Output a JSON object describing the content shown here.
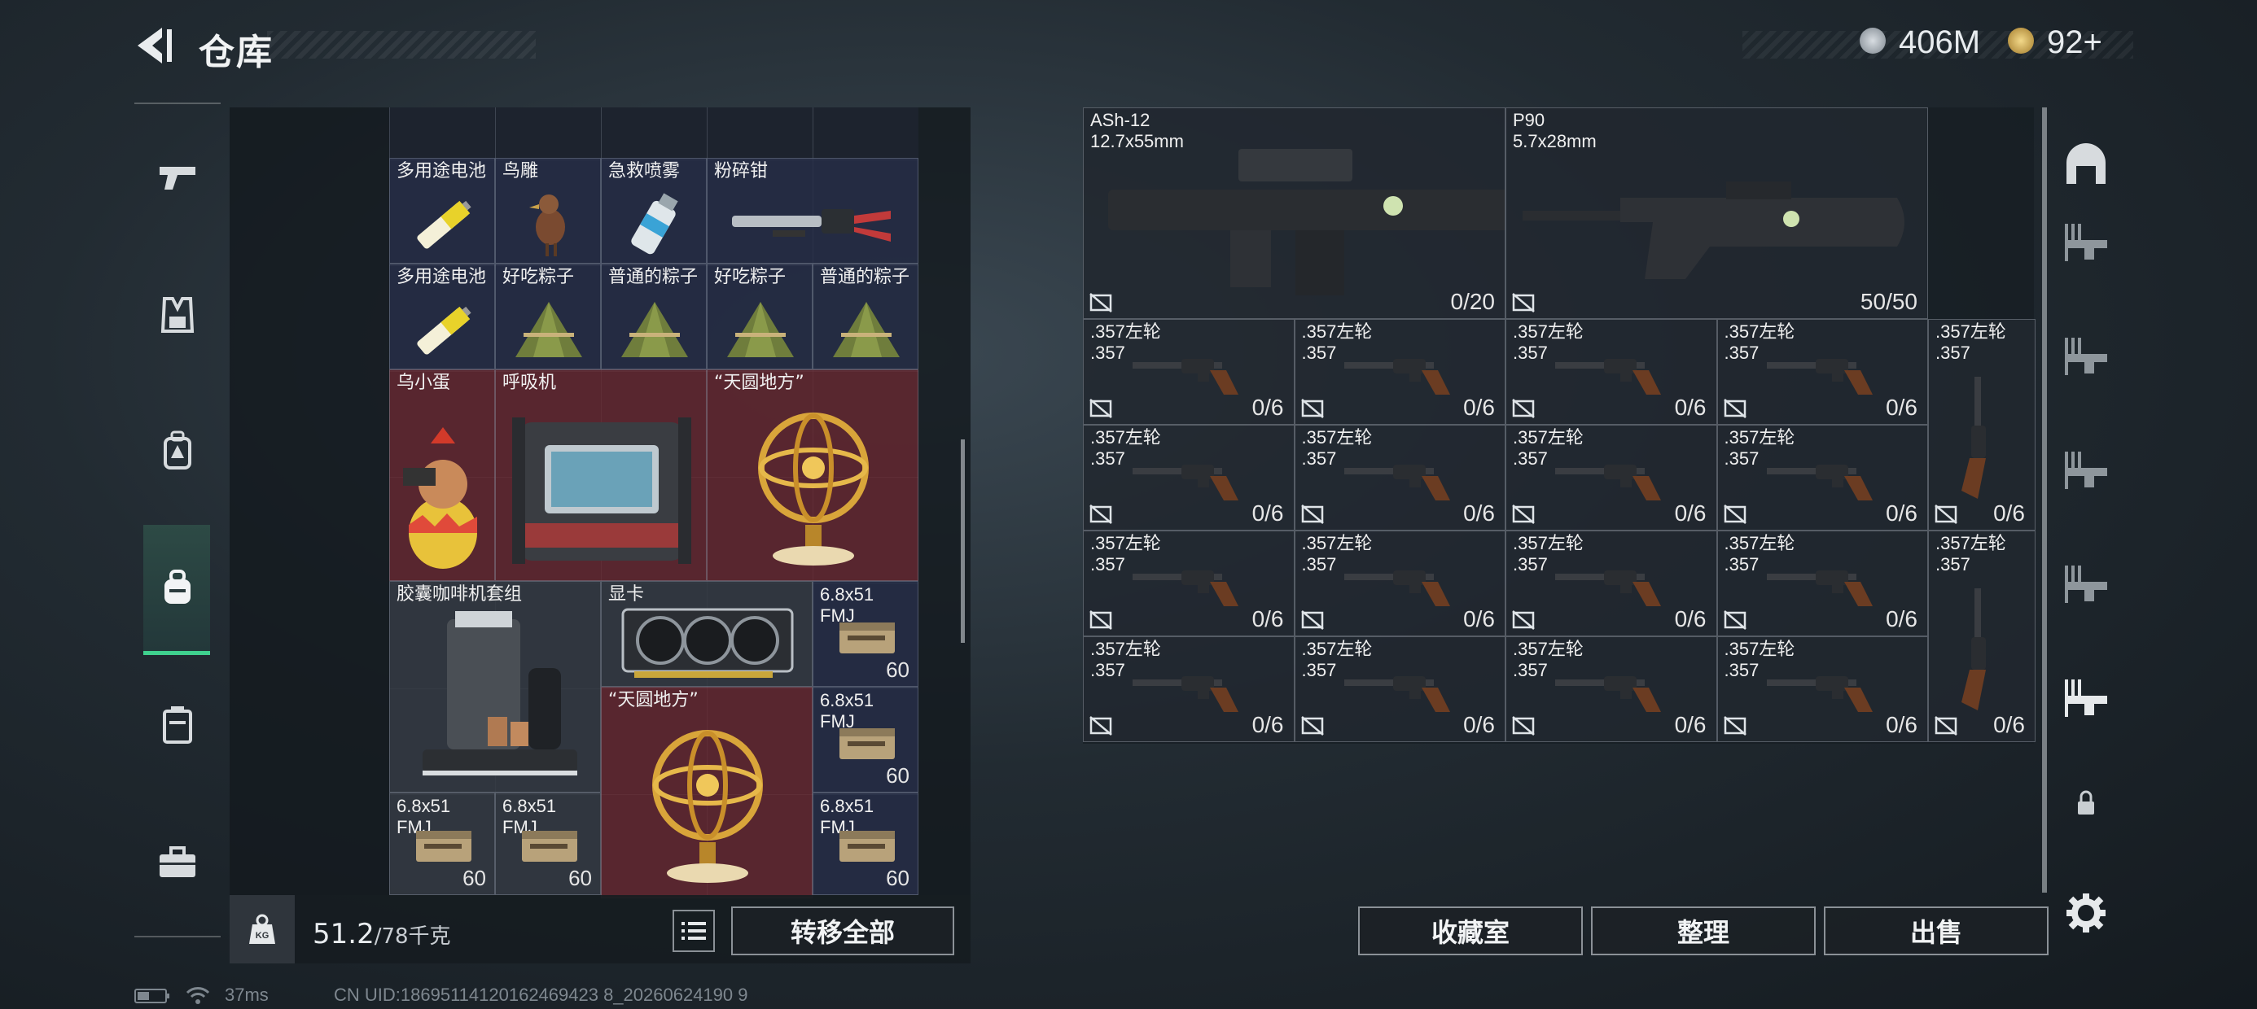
{
  "header": {
    "title": "仓库",
    "currency1": "406M",
    "currency2": "92+"
  },
  "stash": {
    "weight_value": "51.2",
    "weight_max": "/78千克",
    "transfer_all": "转移全部",
    "items": [
      {
        "label": "多用途电池"
      },
      {
        "label": "鸟雕"
      },
      {
        "label": "急救喷雾"
      },
      {
        "label": "粉碎钳"
      },
      {
        "label": "多用途电池"
      },
      {
        "label": "好吃粽子"
      },
      {
        "label": "普通的粽子"
      },
      {
        "label": "好吃粽子"
      },
      {
        "label": "普通的粽子"
      },
      {
        "label": "乌小蛋"
      },
      {
        "label": "呼吸机"
      },
      {
        "label": "“天圆地方”"
      },
      {
        "label": "胶囊咖啡机套组"
      },
      {
        "label": "显卡"
      },
      {
        "label": "6.8x51\nFMJ",
        "count": "60"
      },
      {
        "label": "“天圆地方”"
      },
      {
        "label": "6.8x51\nFMJ",
        "count": "60"
      },
      {
        "label": "6.8x51\nFMJ",
        "count": "60"
      },
      {
        "label": "6.8x51\nFMJ",
        "count": "60"
      },
      {
        "label": "6.8x51\nFMJ",
        "count": "60"
      }
    ]
  },
  "weapons": {
    "big": [
      {
        "name": "ASh-12",
        "caliber": "12.7x55mm",
        "ammo": "0/20"
      },
      {
        "name": "P90",
        "caliber": "5.7x28mm",
        "ammo": "50/50"
      }
    ],
    "small_label": ".357左轮\n.357",
    "small_ammo": "0/6"
  },
  "actions": {
    "collection": "收藏室",
    "organize": "整理",
    "sell": "出售"
  },
  "footer": {
    "ping": "37ms",
    "uid": "CN UID:18695114120162469423 8_20260624190 9"
  }
}
